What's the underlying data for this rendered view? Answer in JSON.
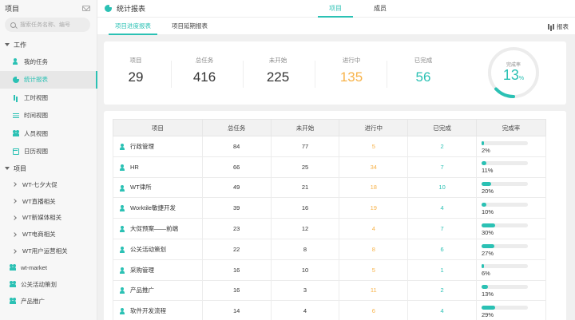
{
  "sidebar": {
    "title": "项目",
    "search_placeholder": "搜索任务名称、编号",
    "work_group": "工作",
    "work_items": [
      {
        "label": "我的任务",
        "icon": "user-icon"
      },
      {
        "label": "统计报表",
        "icon": "pie-chart-icon",
        "active": true
      },
      {
        "label": "工时视图",
        "icon": "bar-chart-icon"
      },
      {
        "label": "时间视图",
        "icon": "timeline-icon"
      },
      {
        "label": "人员视图",
        "icon": "users-icon"
      },
      {
        "label": "日历视图",
        "icon": "calendar-icon"
      }
    ],
    "project_group": "项目",
    "projects": [
      "WT-七夕大促",
      "WT直播相关",
      "WT新媒体相关",
      "WT电商相关",
      "WT用户运营相关"
    ],
    "extras": [
      "wt-market",
      "公关活动策划",
      "产品推广"
    ]
  },
  "topbar": {
    "title": "统计报表",
    "tabs": [
      "项目",
      "成员"
    ]
  },
  "subbar": {
    "tabs": [
      "项目进度报表",
      "项目延期报表"
    ],
    "right_label": "报表"
  },
  "stats": {
    "items": [
      {
        "label": "项目",
        "value": "29"
      },
      {
        "label": "总任务",
        "value": "416"
      },
      {
        "label": "未开始",
        "value": "225"
      },
      {
        "label": "进行中",
        "value": "135"
      },
      {
        "label": "已完成",
        "value": "56"
      }
    ],
    "completion_label": "完成率",
    "completion_value": "13",
    "completion_unit": "%",
    "completion_fraction": 0.13
  },
  "table": {
    "headers": [
      "项目",
      "总任务",
      "未开始",
      "进行中",
      "已完成",
      "完成率"
    ],
    "rows": [
      {
        "name": "行政管理",
        "total": "84",
        "todo": "77",
        "doing": "5",
        "done": "2",
        "rate": "2%",
        "frac": 0.02
      },
      {
        "name": "HR",
        "total": "66",
        "todo": "25",
        "doing": "34",
        "done": "7",
        "rate": "11%",
        "frac": 0.11
      },
      {
        "name": "WT律所",
        "total": "49",
        "todo": "21",
        "doing": "18",
        "done": "10",
        "rate": "20%",
        "frac": 0.2
      },
      {
        "name": "Worktile敏捷开发",
        "total": "39",
        "todo": "16",
        "doing": "19",
        "done": "4",
        "rate": "10%",
        "frac": 0.1
      },
      {
        "name": "大促预案——前端",
        "total": "23",
        "todo": "12",
        "doing": "4",
        "done": "7",
        "rate": "30%",
        "frac": 0.3
      },
      {
        "name": "公关活动策划",
        "total": "22",
        "todo": "8",
        "doing": "8",
        "done": "6",
        "rate": "27%",
        "frac": 0.27
      },
      {
        "name": "采购管理",
        "total": "16",
        "todo": "10",
        "doing": "5",
        "done": "1",
        "rate": "6%",
        "frac": 0.06
      },
      {
        "name": "产品推广",
        "total": "16",
        "todo": "3",
        "doing": "11",
        "done": "2",
        "rate": "13%",
        "frac": 0.13
      },
      {
        "name": "软件开发流程",
        "total": "14",
        "todo": "4",
        "doing": "6",
        "done": "4",
        "rate": "29%",
        "frac": 0.29
      }
    ]
  },
  "colors": {
    "accent": "#2bc1b4",
    "orange": "#f7b34a"
  }
}
